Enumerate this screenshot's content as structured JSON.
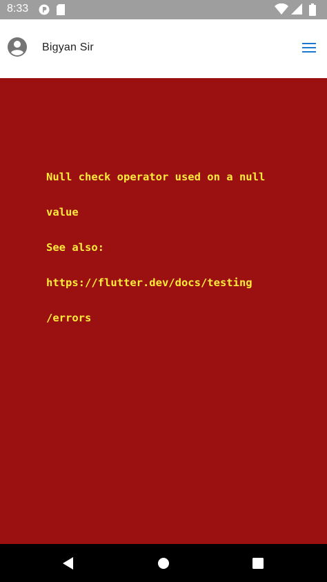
{
  "status_bar": {
    "time": "8:33",
    "left_icons": [
      "notification-p-icon",
      "sim-card-icon"
    ],
    "right_icons": [
      "wifi-icon",
      "signal-icon",
      "battery-icon"
    ]
  },
  "app_bar": {
    "user_name": "Bigyan  Sir",
    "avatar_icon": "account-circle-icon",
    "menu_icon": "hamburger-menu-icon",
    "accent_color": "#1976d2"
  },
  "error": {
    "background_color": "#9b1111",
    "text_color": "#ffeb3b",
    "lines": [
      "Null check operator used on a null",
      "value",
      "See also:",
      "https://flutter.dev/docs/testing",
      "/errors"
    ]
  },
  "nav_bar": {
    "buttons": [
      "back-icon",
      "home-icon",
      "recents-icon"
    ]
  }
}
